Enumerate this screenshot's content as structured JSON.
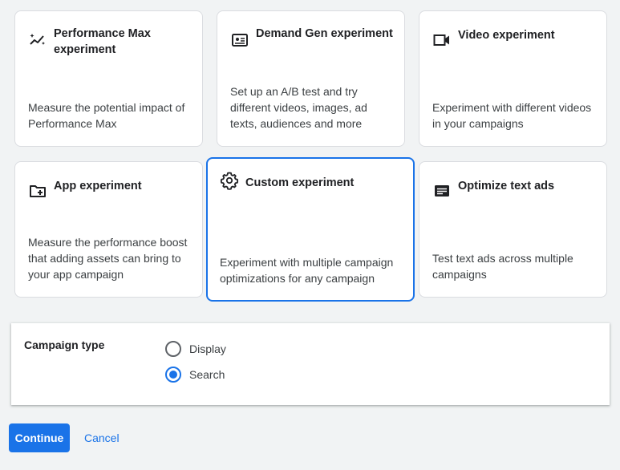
{
  "cards": [
    {
      "icon": "sparkle-chart-icon",
      "title": "Performance Max experiment",
      "description": "Measure the potential impact of Performance Max"
    },
    {
      "icon": "image-card-icon",
      "title": "Demand Gen experiment",
      "description": "Set up an A/B test and try different videos, images, ad texts, audiences and more"
    },
    {
      "icon": "video-camera-icon",
      "title": "Video experiment",
      "description": "Experiment with different videos in your campaigns"
    },
    {
      "icon": "folder-add-icon",
      "title": "App experiment",
      "description": "Measure the performance boost that adding assets can bring to your app campaign"
    },
    {
      "icon": "gear-icon",
      "title": "Custom experiment",
      "description": "Experiment with multiple campaign optimizations for any campaign",
      "selected": true
    },
    {
      "icon": "text-ad-icon",
      "title": "Optimize text ads",
      "description": "Test text ads across multiple campaigns"
    }
  ],
  "campaign_type": {
    "label": "Campaign type",
    "options": [
      {
        "label": "Display",
        "checked": false
      },
      {
        "label": "Search",
        "checked": true
      }
    ]
  },
  "actions": {
    "continue_label": "Continue",
    "cancel_label": "Cancel"
  },
  "colors": {
    "accent": "#1a73e8",
    "background": "#f1f3f4"
  }
}
